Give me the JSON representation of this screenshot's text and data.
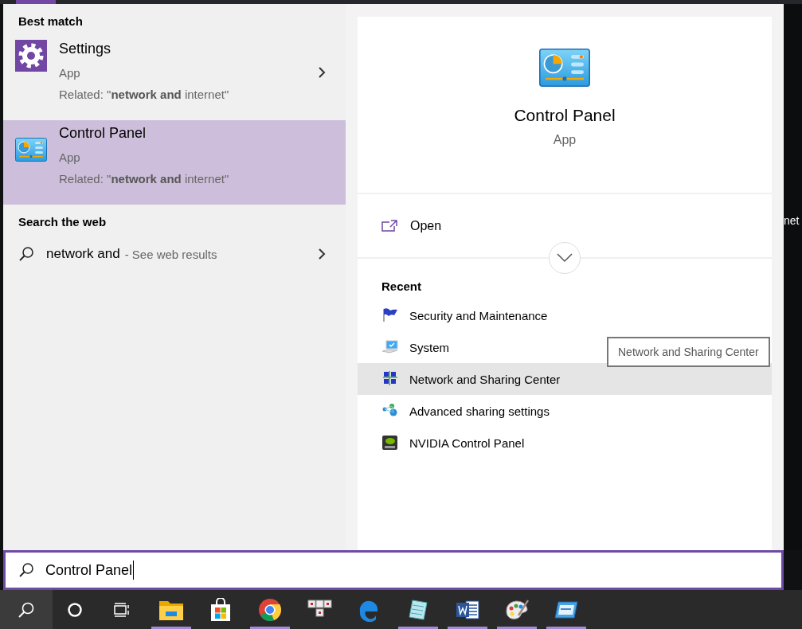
{
  "start_tabs": [
    {
      "selected": true
    }
  ],
  "results": {
    "sections": [
      {
        "heading": "Best match",
        "items": [
          {
            "kind": "app",
            "title": "Settings",
            "type": "App",
            "related": "Related: \"**network and** internet\"",
            "selected": false
          },
          {
            "kind": "app",
            "title": "Control Panel",
            "type": "App",
            "related": "Related: \"**network and** internet\"",
            "selected": true
          }
        ]
      },
      {
        "heading": "Search the web",
        "items": [
          {
            "kind": "web",
            "query": "network and",
            "suffix": "- See web results",
            "selected": false
          }
        ]
      }
    ]
  },
  "detail": {
    "title": "Control Panel",
    "type": "App",
    "actions": [
      {
        "label": "Open"
      }
    ],
    "recent_heading": "Recent",
    "recent": [
      {
        "label": "Security and Maintenance",
        "selected": false
      },
      {
        "label": "System",
        "selected": false
      },
      {
        "label": "Network and Sharing Center",
        "selected": true
      },
      {
        "label": "Advanced sharing settings",
        "selected": false
      },
      {
        "label": "NVIDIA Control Panel",
        "selected": false
      }
    ]
  },
  "tooltip": {
    "text": "Network and Sharing Center"
  },
  "background_text": "net",
  "search": {
    "value": "Control Panel"
  },
  "taskbar": {
    "items": [
      {
        "running": true
      },
      {
        "running": false
      },
      {
        "running": true
      },
      {
        "running": false
      },
      {
        "running": false
      },
      {
        "running": true
      },
      {
        "running": true
      },
      {
        "running": true
      },
      {
        "running": true
      }
    ]
  }
}
